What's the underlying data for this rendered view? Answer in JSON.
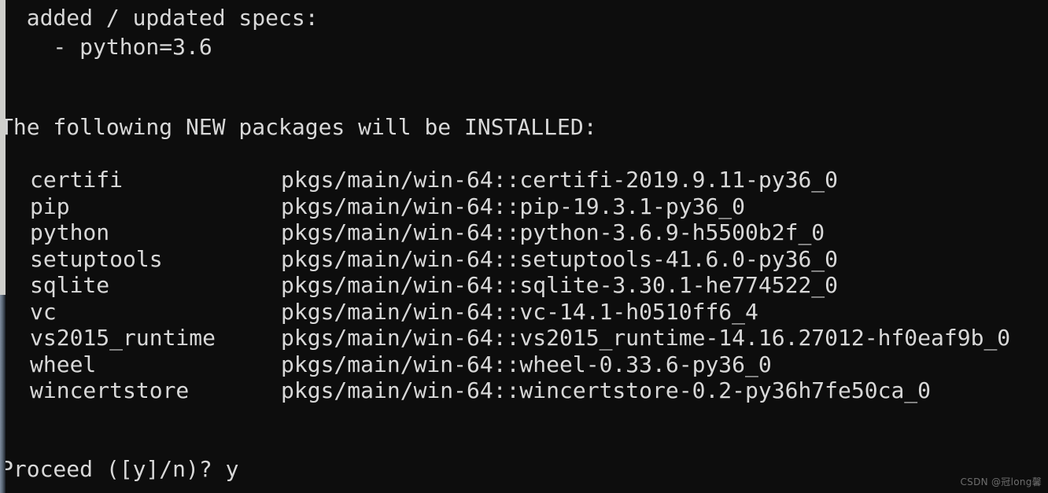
{
  "terminal": {
    "background_color": "#0d0d0d",
    "text_color": "#d8d8d8",
    "specs_header": "  added / updated specs:",
    "spec_item": "    - python=3.6",
    "installed_header": "The following NEW packages will be INSTALLED:",
    "prompt": "Proceed ([y]/n)? y",
    "packages": [
      {
        "name": "certifi",
        "spec": "pkgs/main/win-64::certifi-2019.9.11-py36_0"
      },
      {
        "name": "pip",
        "spec": "pkgs/main/win-64::pip-19.3.1-py36_0"
      },
      {
        "name": "python",
        "spec": "pkgs/main/win-64::python-3.6.9-h5500b2f_0"
      },
      {
        "name": "setuptools",
        "spec": "pkgs/main/win-64::setuptools-41.6.0-py36_0"
      },
      {
        "name": "sqlite",
        "spec": "pkgs/main/win-64::sqlite-3.30.1-he774522_0"
      },
      {
        "name": "vc",
        "spec": "pkgs/main/win-64::vc-14.1-h0510ff6_4"
      },
      {
        "name": "vs2015_runtime",
        "spec": "pkgs/main/win-64::vs2015_runtime-14.16.27012-hf0eaf9b_0"
      },
      {
        "name": "wheel",
        "spec": "pkgs/main/win-64::wheel-0.33.6-py36_0"
      },
      {
        "name": "wincertstore",
        "spec": "pkgs/main/win-64::wincertstore-0.2-py36h7fe50ca_0"
      }
    ]
  },
  "scrollbar": {
    "thumb_color": "#cfcfcb",
    "track_color": "#2b3440"
  },
  "watermark": {
    "text": "CSDN @冠long馨",
    "color": "#6e6e6e"
  }
}
